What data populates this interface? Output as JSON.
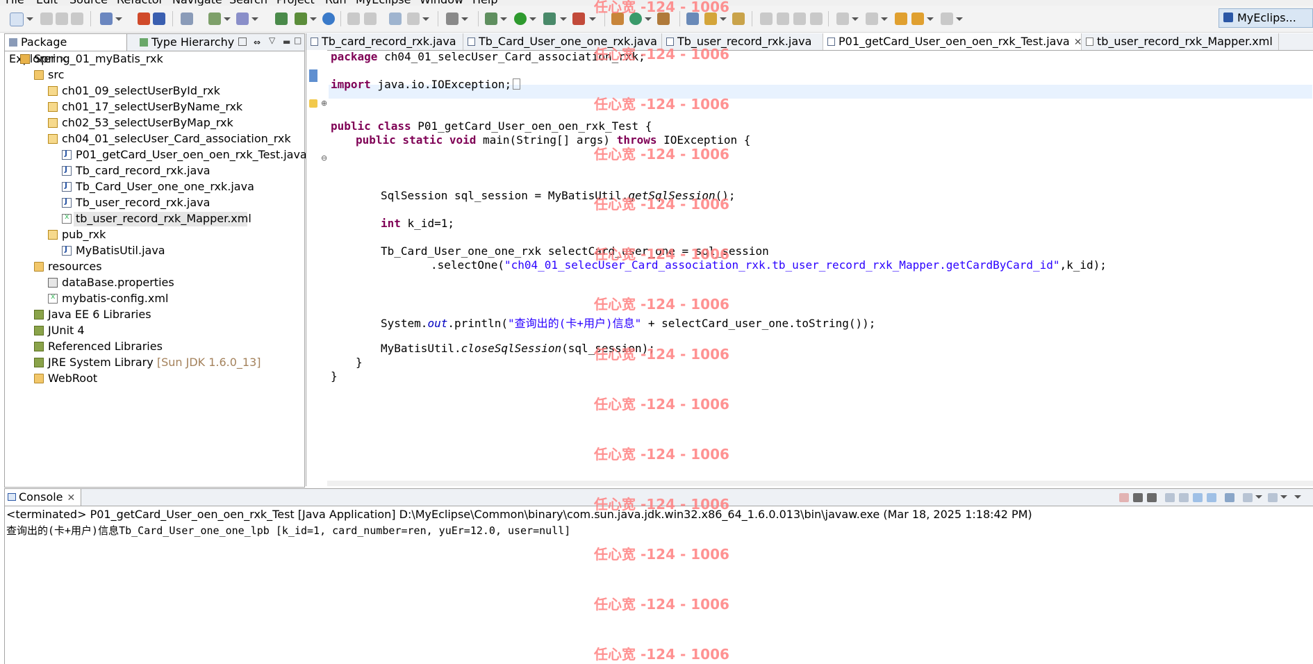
{
  "menu": [
    "File",
    "Edit",
    "Source",
    "Refactor",
    "Navigate",
    "Search",
    "Project",
    "Run",
    "MyEclipse",
    "Window",
    "Help"
  ],
  "perspective": {
    "label": "MyEclips..."
  },
  "left_panel": {
    "tabs": [
      {
        "label": "Package Explorer"
      },
      {
        "label": "Type Hierarchy"
      }
    ],
    "tree": [
      {
        "label": "Spring_01_myBatis_rxk",
        "icon": "project-icon"
      },
      {
        "label": "src",
        "icon": "source-folder-icon"
      },
      {
        "label": "ch01_09_selectUserById_rxk",
        "icon": "package-icon"
      },
      {
        "label": "ch01_17_selectUserByName_rxk",
        "icon": "package-icon"
      },
      {
        "label": "ch02_53_selectUserByMap_rxk",
        "icon": "package-icon"
      },
      {
        "label": "ch04_01_selecUser_Card_association_rxk",
        "icon": "package-icon"
      },
      {
        "label": "P01_getCard_User_oen_oen_rxk_Test.java",
        "icon": "java-file-icon"
      },
      {
        "label": "Tb_card_record_rxk.java",
        "icon": "java-file-icon"
      },
      {
        "label": "Tb_Card_User_one_one_rxk.java",
        "icon": "java-file-icon"
      },
      {
        "label": "Tb_user_record_rxk.java",
        "icon": "java-file-icon"
      },
      {
        "label": "tb_user_record_rxk_Mapper.xml",
        "icon": "xml-file-icon"
      },
      {
        "label": "pub_rxk",
        "icon": "package-icon"
      },
      {
        "label": "MyBatisUtil.java",
        "icon": "java-file-icon"
      },
      {
        "label": "resources",
        "icon": "source-folder-icon"
      },
      {
        "label": "dataBase.properties",
        "icon": "properties-file-icon"
      },
      {
        "label": "mybatis-config.xml",
        "icon": "xml-file-icon"
      },
      {
        "label": "Java EE 6 Libraries",
        "icon": "library-icon"
      },
      {
        "label": "JUnit 4",
        "icon": "library-icon"
      },
      {
        "label": "Referenced Libraries",
        "icon": "library-icon"
      },
      {
        "label": "JRE System Library",
        "suffix": "[Sun JDK 1.6.0_13]",
        "icon": "library-icon"
      },
      {
        "label": "WebRoot",
        "icon": "folder-icon"
      }
    ]
  },
  "editor": {
    "tabs": [
      {
        "label": "Tb_card_record_rxk.java"
      },
      {
        "label": "Tb_Card_User_one_one_rxk.java"
      },
      {
        "label": "Tb_user_record_rxk.java"
      },
      {
        "label": "P01_getCard_User_oen_oen_rxk_Test.java"
      },
      {
        "label": "tb_user_record_rxk_Mapper.xml"
      }
    ],
    "code": {
      "l1_kw": "package",
      "l1_rest": " ch04_01_selecUser_Card_association_rxk;",
      "l2_kw": "import",
      "l2_rest": " java.io.IOException;",
      "l3_kw": "public class",
      "l3_rest": " P01_getCard_User_oen_oen_rxk_Test {",
      "l4_kw1": "public static void",
      "l4_mid": " main(String[] args) ",
      "l4_kw2": "throws",
      "l4_rest": " IOException {",
      "l5_a": "SqlSession sql_session = MyBatisUtil.",
      "l5_b": "getSqlSession",
      "l5_c": "();",
      "l6_kw": "int",
      "l6_rest": " k_id=1;",
      "l7": "Tb_Card_User_one_one_rxk selectCard_user_one = sql_session",
      "l8_a": ".selectOne(",
      "l8_str": "\"ch04_01_selecUser_Card_association_rxk.tb_user_record_rxk_Mapper.getCardByCard_id\"",
      "l8_c": ",k_id);",
      "l9_a": "System.",
      "l9_fld": "out",
      "l9_b": ".println(",
      "l9_str": "\"查询出的(卡+用户)信息\"",
      "l9_c": " + selectCard_user_one.toString());",
      "l10_a": "MyBatisUtil.",
      "l10_b": "closeSqlSession",
      "l10_c": "(sql_session);",
      "l11": "}",
      "l12": "}"
    }
  },
  "console": {
    "tab_label": "Console",
    "status": "<terminated> P01_getCard_User_oen_oen_rxk_Test [Java Application] D:\\MyEclipse\\Common\\binary\\com.sun.java.jdk.win32.x86_64_1.6.0.013\\bin\\javaw.exe (Mar 18, 2025 1:18:42 PM)",
    "output": "查询出的(卡+用户)信息Tb_Card_User_one_one_lpb [k_id=1, card_number=ren, yuEr=12.0, user=null]"
  },
  "watermark": "任心宽 -124 - 1006"
}
